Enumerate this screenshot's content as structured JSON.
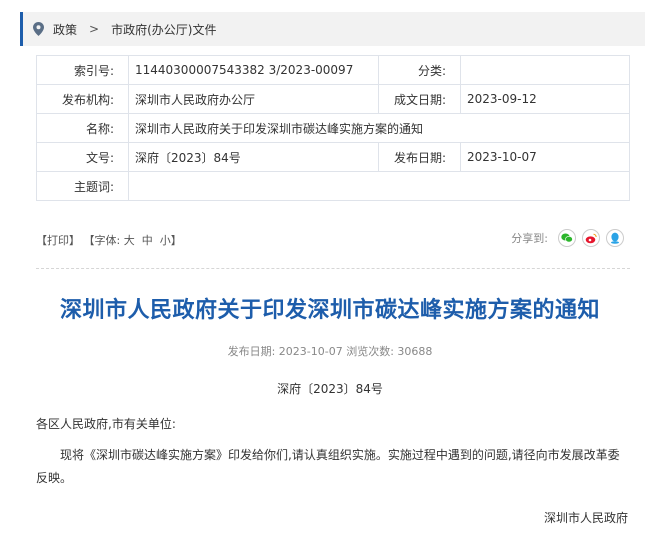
{
  "breadcrumb": {
    "items": [
      "政策",
      "市政府(办公厅)文件"
    ],
    "separator": ">"
  },
  "meta": {
    "index_label": "索引号:",
    "index_value": "11440300007543382 3/2023-00097",
    "category_label": "分类:",
    "category_value": "",
    "publisher_label": "发布机构:",
    "publisher_value": "深圳市人民政府办公厅",
    "created_label": "成文日期:",
    "created_value": "2023-09-12",
    "name_label": "名称:",
    "name_value": "深圳市人民政府关于印发深圳市碳达峰实施方案的通知",
    "docno_label": "文号:",
    "docno_value": "深府〔2023〕84号",
    "published_label": "发布日期:",
    "published_value": "2023-10-07",
    "topic_label": "主题词:",
    "topic_value": ""
  },
  "tools": {
    "print": "【打印】",
    "font_prefix": "【字体:",
    "font_large": "大",
    "font_medium": "中",
    "font_small": "小",
    "font_suffix": "】"
  },
  "share": {
    "label": "分享到:",
    "icons": [
      "wechat-icon",
      "weibo-icon",
      "qq-icon"
    ],
    "colors": {
      "wechat": "#2bb52b",
      "weibo": "#e6162d",
      "qq": "#2aa3e6"
    }
  },
  "article": {
    "title": "深圳市人民政府关于印发深圳市碳达峰实施方案的通知",
    "publish_line": "发布日期:  2023-10-07  浏览次数:  30688",
    "doc_number": "深府〔2023〕84号",
    "addressee": "各区人民政府,市有关单位:",
    "body": "现将《深圳市碳达峰实施方案》印发给你们,请认真组织实施。实施过程中遇到的问题,请径向市发展改革委反映。",
    "signature": "深圳市人民政府"
  },
  "colors": {
    "accent": "#1d5dab",
    "border": "#dfe3ea"
  }
}
